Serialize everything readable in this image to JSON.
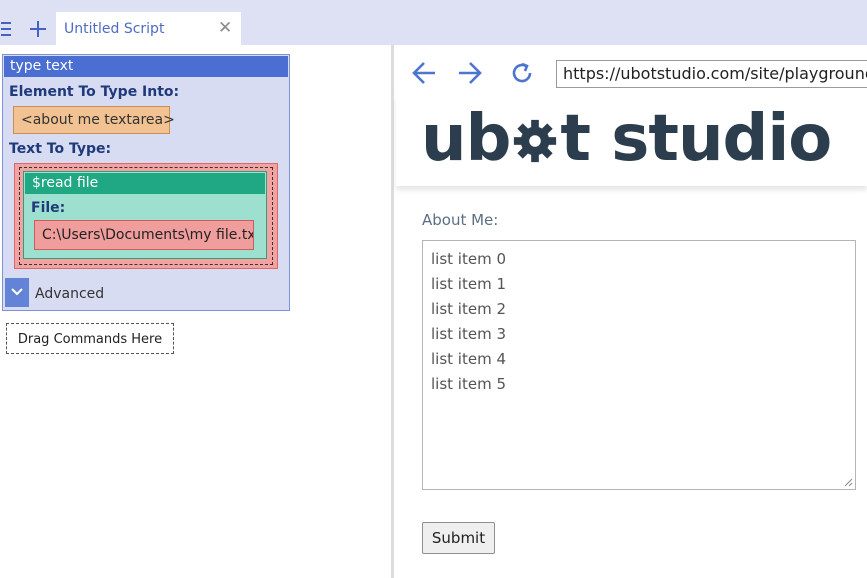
{
  "tabbar": {
    "menu_icon": "hamburger-menu-icon",
    "add_icon": "plus-icon",
    "tab_title": "Untitled Script",
    "close_glyph": "✕",
    "accent": "#4561c6"
  },
  "script": {
    "command_title": "type text",
    "element_label": "Element To Type Into:",
    "element_value": "<about me textarea>",
    "text_label": "Text To Type:",
    "function_title": "$read file",
    "file_label": "File:",
    "file_value": "C:\\Users\\Documents\\my file.txt",
    "advanced_label": "Advanced",
    "drag_hint": "Drag Commands Here",
    "colors": {
      "command": "#4a6ed1",
      "function": "#20a885",
      "element_chip": "#f2c293",
      "file_chip": "#f09d9d"
    }
  },
  "browser": {
    "back_icon": "arrow-left-icon",
    "forward_icon": "arrow-right-icon",
    "reload_icon": "reload-icon",
    "url": "https://ubotstudio.com/site/playground",
    "logo_text_left": "ub",
    "logo_text_right": "t studio",
    "about_label": "About Me:",
    "textarea_lines": [
      "list item 0",
      "list item 1",
      "list item 2",
      "list item 3",
      "list item 4",
      "list item 5"
    ],
    "submit_label": "Submit"
  }
}
